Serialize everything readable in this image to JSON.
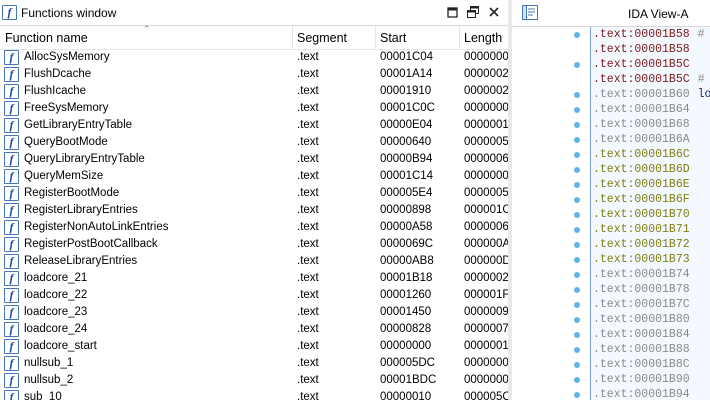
{
  "functions_window": {
    "title": "Functions window",
    "columns": [
      "Function name",
      "Segment",
      "Start",
      "Length"
    ],
    "rows": [
      {
        "name": "AllocSysMemory",
        "segment": ".text",
        "start": "00001C04",
        "length": "0000000"
      },
      {
        "name": "FlushDcache",
        "segment": ".text",
        "start": "00001A14",
        "length": "0000002"
      },
      {
        "name": "FlushIcache",
        "segment": ".text",
        "start": "00001910",
        "length": "0000002"
      },
      {
        "name": "FreeSysMemory",
        "segment": ".text",
        "start": "00001C0C",
        "length": "0000000"
      },
      {
        "name": "GetLibraryEntryTable",
        "segment": ".text",
        "start": "00000E04",
        "length": "0000001"
      },
      {
        "name": "QueryBootMode",
        "segment": ".text",
        "start": "00000640",
        "length": "0000005"
      },
      {
        "name": "QueryLibraryEntryTable",
        "segment": ".text",
        "start": "00000B94",
        "length": "0000006"
      },
      {
        "name": "QueryMemSize",
        "segment": ".text",
        "start": "00001C14",
        "length": "0000000"
      },
      {
        "name": "RegisterBootMode",
        "segment": ".text",
        "start": "000005E4",
        "length": "0000005"
      },
      {
        "name": "RegisterLibraryEntries",
        "segment": ".text",
        "start": "00000898",
        "length": "000001C"
      },
      {
        "name": "RegisterNonAutoLinkEntries",
        "segment": ".text",
        "start": "00000A58",
        "length": "0000006"
      },
      {
        "name": "RegisterPostBootCallback",
        "segment": ".text",
        "start": "0000069C",
        "length": "000000A"
      },
      {
        "name": "ReleaseLibraryEntries",
        "segment": ".text",
        "start": "00000AB8",
        "length": "000000D"
      },
      {
        "name": "loadcore_21",
        "segment": ".text",
        "start": "00001B18",
        "length": "0000002"
      },
      {
        "name": "loadcore_22",
        "segment": ".text",
        "start": "00001260",
        "length": "000001F"
      },
      {
        "name": "loadcore_23",
        "segment": ".text",
        "start": "00001450",
        "length": "0000009"
      },
      {
        "name": "loadcore_24",
        "segment": ".text",
        "start": "00000828",
        "length": "0000007"
      },
      {
        "name": "loadcore_start",
        "segment": ".text",
        "start": "00000000",
        "length": "0000001"
      },
      {
        "name": "nullsub_1",
        "segment": ".text",
        "start": "000005DC",
        "length": "0000000"
      },
      {
        "name": "nullsub_2",
        "segment": ".text",
        "start": "00001BDC",
        "length": "0000000"
      },
      {
        "name": "sub_10",
        "segment": ".text",
        "start": "00000010",
        "length": "000005C"
      }
    ],
    "icons": {
      "function": "f-function-icon",
      "pin": "pin-icon",
      "restore": "restore-icon",
      "close": "close-icon"
    }
  },
  "ida_view": {
    "title": "IDA View-A",
    "lines": [
      {
        "text": ".text:00001B58",
        "extra": "#",
        "color": "red",
        "dot": true
      },
      {
        "text": ".text:00001B58",
        "extra": "",
        "color": "red",
        "dot": false
      },
      {
        "text": ".text:00001B5C",
        "extra": "",
        "color": "red",
        "dot": true
      },
      {
        "text": ".text:00001B5C",
        "extra": "#",
        "color": "red",
        "dot": false
      },
      {
        "text": ".text:00001B60",
        "extra": "lo",
        "color": "gray",
        "dot": true
      },
      {
        "text": ".text:00001B64",
        "extra": "",
        "color": "gray",
        "dot": true
      },
      {
        "text": ".text:00001B68",
        "extra": "",
        "color": "gray",
        "dot": true
      },
      {
        "text": ".text:00001B6A",
        "extra": "",
        "color": "gray",
        "dot": true
      },
      {
        "text": ".text:00001B6C",
        "extra": "",
        "color": "olive",
        "dot": true
      },
      {
        "text": ".text:00001B6D",
        "extra": "",
        "color": "olive",
        "dot": true
      },
      {
        "text": ".text:00001B6E",
        "extra": "",
        "color": "olive",
        "dot": true
      },
      {
        "text": ".text:00001B6F",
        "extra": "",
        "color": "olive",
        "dot": true
      },
      {
        "text": ".text:00001B70",
        "extra": "",
        "color": "olive",
        "dot": true
      },
      {
        "text": ".text:00001B71",
        "extra": "",
        "color": "olive",
        "dot": true
      },
      {
        "text": ".text:00001B72",
        "extra": "",
        "color": "olive",
        "dot": true
      },
      {
        "text": ".text:00001B73",
        "extra": "",
        "color": "olive",
        "dot": true
      },
      {
        "text": ".text:00001B74",
        "extra": "",
        "color": "gray",
        "dot": true
      },
      {
        "text": ".text:00001B78",
        "extra": "",
        "color": "gray",
        "dot": true
      },
      {
        "text": ".text:00001B7C",
        "extra": "",
        "color": "gray",
        "dot": true
      },
      {
        "text": ".text:00001B80",
        "extra": "",
        "color": "gray",
        "dot": true
      },
      {
        "text": ".text:00001B84",
        "extra": "",
        "color": "gray",
        "dot": true
      },
      {
        "text": ".text:00001B88",
        "extra": "",
        "color": "gray",
        "dot": true
      },
      {
        "text": ".text:00001B8C",
        "extra": "",
        "color": "gray",
        "dot": true
      },
      {
        "text": ".text:00001B90",
        "extra": "",
        "color": "gray",
        "dot": true
      },
      {
        "text": ".text:00001B94",
        "extra": "",
        "color": "gray",
        "dot": true
      }
    ],
    "icons": {
      "view": "disassembly-view-icon"
    }
  },
  "colors": {
    "red": "#7a1a1a",
    "gray": "#8a8a8a",
    "olive": "#7f7f10",
    "accent": "#4a76b6",
    "code_bg": "#f4f8ff",
    "dot": "#5fb4e8"
  }
}
